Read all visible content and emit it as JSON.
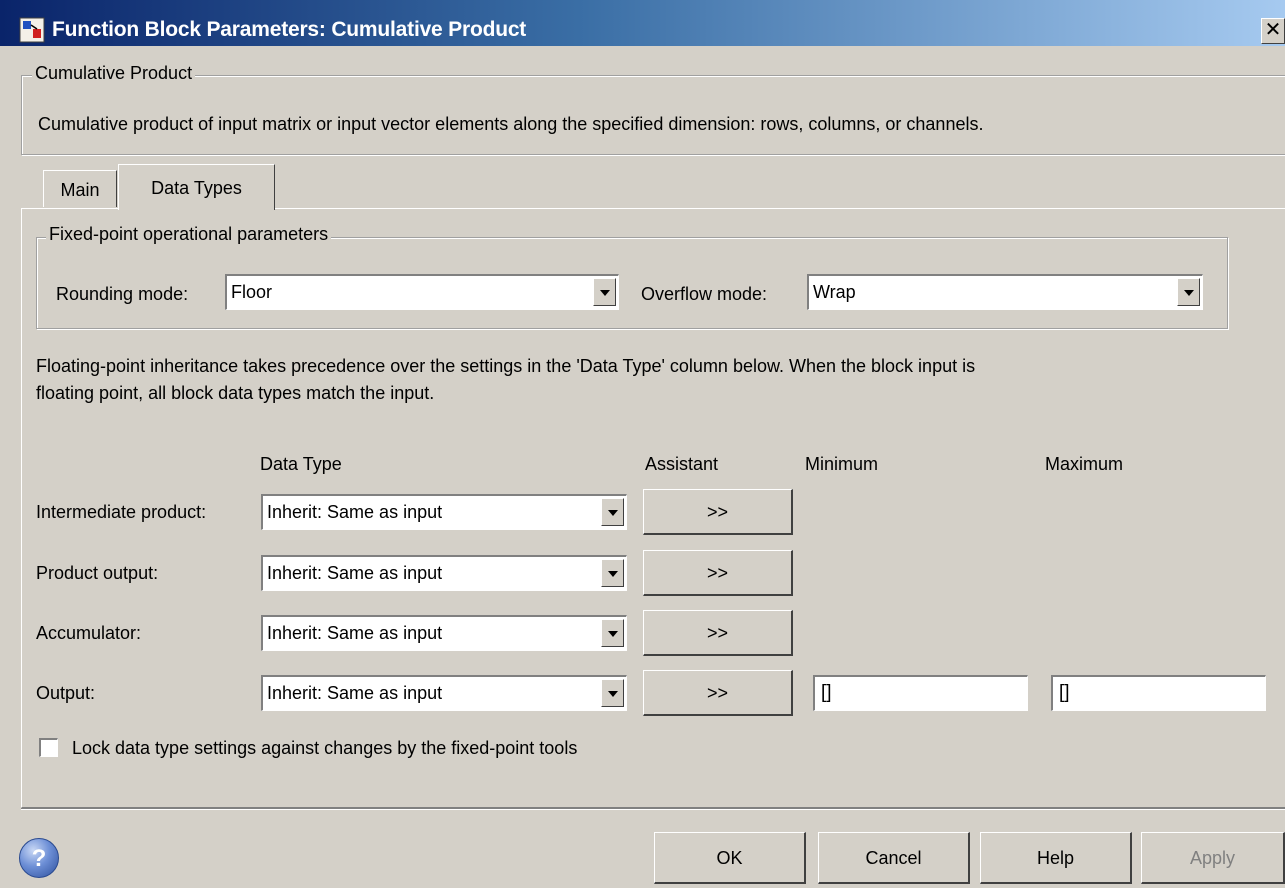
{
  "window": {
    "title": "Function Block Parameters: Cumulative Product",
    "close_glyph": "✕",
    "icon": "simulink-block-icon"
  },
  "description_group": {
    "legend": "Cumulative Product",
    "text": "Cumulative product of input matrix or input vector elements along the specified dimension: rows, columns, or channels."
  },
  "tabs": [
    {
      "label": "Main",
      "selected": false
    },
    {
      "label": "Data Types",
      "selected": true
    }
  ],
  "fixed_point_group": {
    "legend": "Fixed-point operational parameters",
    "rounding_label": "Rounding mode:",
    "rounding_value": "Floor",
    "overflow_label": "Overflow mode:",
    "overflow_value": "Wrap"
  },
  "inheritance_note": {
    "line1": "Floating-point inheritance takes precedence over the settings in the 'Data Type' column below. When the block input is",
    "line2": "floating point, all block data types match the input."
  },
  "table": {
    "headers": {
      "data_type": "Data Type",
      "assistant": "Assistant",
      "minimum": "Minimum",
      "maximum": "Maximum"
    },
    "rows": [
      {
        "label": "Intermediate product:",
        "data_type": "Inherit: Same as input",
        "assistant": ">>"
      },
      {
        "label": "Product output:",
        "data_type": "Inherit: Same as input",
        "assistant": ">>"
      },
      {
        "label": "Accumulator:",
        "data_type": "Inherit: Same as input",
        "assistant": ">>"
      },
      {
        "label": "Output:",
        "data_type": "Inherit: Same as input",
        "assistant": ">>",
        "minimum": "[]",
        "maximum": "[]"
      }
    ]
  },
  "lock_checkbox": {
    "label": "Lock data type settings against changes by the fixed-point tools",
    "checked": false
  },
  "footer": {
    "help_icon": "?",
    "buttons": {
      "ok": "OK",
      "cancel": "Cancel",
      "help": "Help",
      "apply": "Apply"
    },
    "apply_enabled": false
  },
  "colors": {
    "window_bg": "#d4d0c8",
    "title_gradient_start": "#0a246a",
    "title_gradient_end": "#a6caf0",
    "disabled_text": "#808080"
  }
}
